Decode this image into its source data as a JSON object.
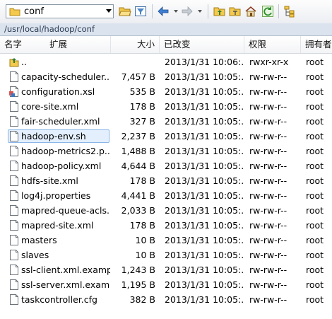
{
  "toolbar": {
    "location": "conf"
  },
  "path": "/usr/local/hadoop/conf",
  "columns": {
    "name": "名字",
    "ext": "扩展",
    "size": "大小",
    "modified": "已改变",
    "permissions": "权限",
    "owner": "拥有者"
  },
  "files": [
    {
      "name": "..",
      "size": "",
      "modified": "2013/1/31 10:06:...",
      "perm": "rwxr-xr-x",
      "owner": "root",
      "icon": "parent-folder-icon"
    },
    {
      "name": "capacity-scheduler....",
      "size": "7,457 B",
      "modified": "2013/1/31 10:05:...",
      "perm": "rw-rw-r--",
      "owner": "root",
      "icon": "file-icon"
    },
    {
      "name": "configuration.xsl",
      "size": "535 B",
      "modified": "2013/1/31 10:05:...",
      "perm": "rw-rw-r--",
      "owner": "root",
      "icon": "xsl-file-icon"
    },
    {
      "name": "core-site.xml",
      "size": "178 B",
      "modified": "2013/1/31 10:05:...",
      "perm": "rw-rw-r--",
      "owner": "root",
      "icon": "file-icon"
    },
    {
      "name": "fair-scheduler.xml",
      "size": "327 B",
      "modified": "2013/1/31 10:05:...",
      "perm": "rw-rw-r--",
      "owner": "root",
      "icon": "file-icon"
    },
    {
      "name": "hadoop-env.sh",
      "size": "2,237 B",
      "modified": "2013/1/31 10:05:...",
      "perm": "rw-rw-r--",
      "owner": "root",
      "icon": "file-icon",
      "selected": true
    },
    {
      "name": "hadoop-metrics2.p...",
      "size": "1,488 B",
      "modified": "2013/1/31 10:05:...",
      "perm": "rw-rw-r--",
      "owner": "root",
      "icon": "file-icon"
    },
    {
      "name": "hadoop-policy.xml",
      "size": "4,644 B",
      "modified": "2013/1/31 10:05:...",
      "perm": "rw-rw-r--",
      "owner": "root",
      "icon": "file-icon"
    },
    {
      "name": "hdfs-site.xml",
      "size": "178 B",
      "modified": "2013/1/31 10:05:...",
      "perm": "rw-rw-r--",
      "owner": "root",
      "icon": "file-icon"
    },
    {
      "name": "log4j.properties",
      "size": "4,441 B",
      "modified": "2013/1/31 10:05:...",
      "perm": "rw-rw-r--",
      "owner": "root",
      "icon": "file-icon"
    },
    {
      "name": "mapred-queue-acls...",
      "size": "2,033 B",
      "modified": "2013/1/31 10:05:...",
      "perm": "rw-rw-r--",
      "owner": "root",
      "icon": "file-icon"
    },
    {
      "name": "mapred-site.xml",
      "size": "178 B",
      "modified": "2013/1/31 10:05:...",
      "perm": "rw-rw-r--",
      "owner": "root",
      "icon": "file-icon"
    },
    {
      "name": "masters",
      "size": "10 B",
      "modified": "2013/1/31 10:05:...",
      "perm": "rw-rw-r--",
      "owner": "root",
      "icon": "file-icon"
    },
    {
      "name": "slaves",
      "size": "10 B",
      "modified": "2013/1/31 10:05:...",
      "perm": "rw-rw-r--",
      "owner": "root",
      "icon": "file-icon"
    },
    {
      "name": "ssl-client.xml.examp...",
      "size": "1,243 B",
      "modified": "2013/1/31 10:05:...",
      "perm": "rw-rw-r--",
      "owner": "root",
      "icon": "file-icon"
    },
    {
      "name": "ssl-server.xml.exam...",
      "size": "1,195 B",
      "modified": "2013/1/31 10:05:...",
      "perm": "rw-rw-r--",
      "owner": "root",
      "icon": "file-icon"
    },
    {
      "name": "taskcontroller.cfg",
      "size": "382 B",
      "modified": "2013/1/31 10:05:...",
      "perm": "rw-rw-r--",
      "owner": "root",
      "icon": "file-icon"
    }
  ],
  "colors": {
    "selection_fill": "#e3effc",
    "selection_border": "#8bb7e8",
    "pathbar": "#dbe3ee"
  }
}
